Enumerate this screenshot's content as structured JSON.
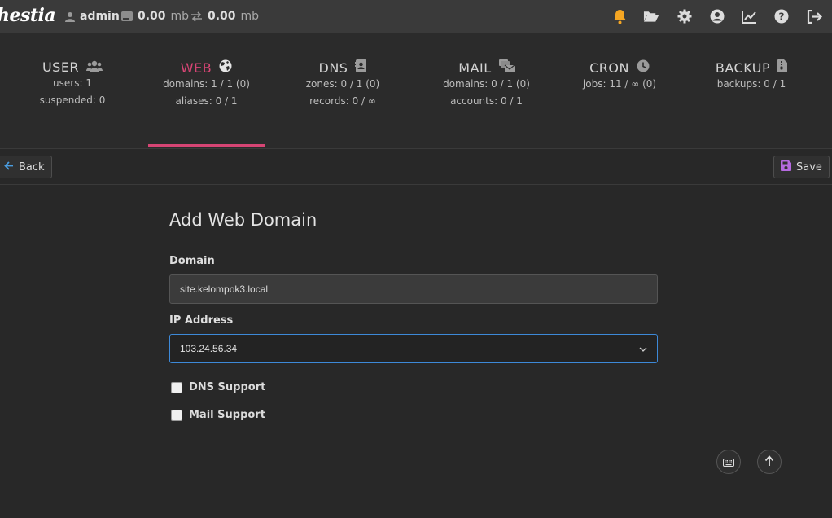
{
  "topbar": {
    "logo": "hestia",
    "user": "admin",
    "disk": {
      "value": "0.00",
      "unit": "mb"
    },
    "bandwidth": {
      "value": "0.00",
      "unit": "mb"
    },
    "icons": [
      "bell-icon",
      "folder-open-icon",
      "gear-icon",
      "user-circle-icon",
      "chart-line-icon",
      "help-icon",
      "logout-icon"
    ],
    "bell_color": "#f5a623"
  },
  "tabs": [
    {
      "title": "USER",
      "icon": "users-icon",
      "lines": [
        "users: 1",
        "suspended: 0"
      ]
    },
    {
      "title": "WEB",
      "icon": "globe-icon",
      "lines": [
        "domains: 1 / 1 (0)",
        "aliases: 0 / 1"
      ],
      "active": true
    },
    {
      "title": "DNS",
      "icon": "address-book-icon",
      "lines": [
        "zones: 0 / 1 (0)",
        "records: 0 / ∞"
      ]
    },
    {
      "title": "MAIL",
      "icon": "mail-bulk-icon",
      "lines": [
        "domains: 0 / 1 (0)",
        "accounts: 0 / 1"
      ]
    },
    {
      "title": "CRON",
      "icon": "clock-icon",
      "lines": [
        "jobs: 11 / ∞ (0)"
      ]
    },
    {
      "title": "BACKUP",
      "icon": "file-archive-icon",
      "lines": [
        "backups: 0 / 1"
      ]
    }
  ],
  "accent_color": "#d64574",
  "toolbar": {
    "back_label": "Back",
    "save_label": "Save"
  },
  "form": {
    "title": "Add Web Domain",
    "domain_label": "Domain",
    "domain_value": "site.kelompok3.local",
    "ip_label": "IP Address",
    "ip_value": "103.24.56.34",
    "dns_support_label": "DNS Support",
    "mail_support_label": "Mail Support",
    "dns_support_checked": false,
    "mail_support_checked": false
  }
}
